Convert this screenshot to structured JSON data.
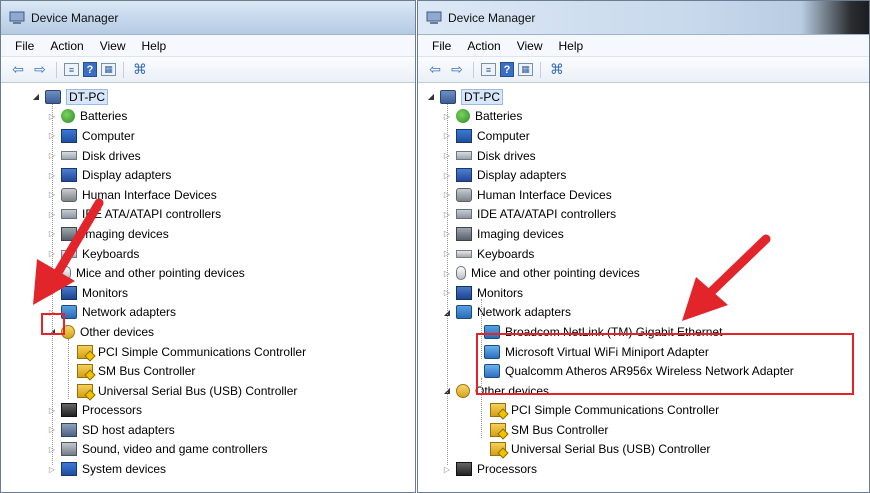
{
  "left": {
    "title": "Device Manager",
    "menu": [
      "File",
      "Action",
      "View",
      "Help"
    ],
    "root": "DT-PC",
    "items": [
      {
        "label": "Batteries",
        "icon": "battery-icon"
      },
      {
        "label": "Computer",
        "icon": "computer-icon"
      },
      {
        "label": "Disk drives",
        "icon": "disk-drive-icon"
      },
      {
        "label": "Display adapters",
        "icon": "display-adapter-icon"
      },
      {
        "label": "Human Interface Devices",
        "icon": "hid-icon"
      },
      {
        "label": "IDE ATA/ATAPI controllers",
        "icon": "ide-controller-icon"
      },
      {
        "label": "Imaging devices",
        "icon": "imaging-device-icon"
      },
      {
        "label": "Keyboards",
        "icon": "keyboard-icon"
      },
      {
        "label": "Mice and other pointing devices",
        "icon": "mouse-icon"
      },
      {
        "label": "Monitors",
        "icon": "monitor-icon"
      },
      {
        "label": "Network adapters",
        "icon": "network-adapter-icon"
      },
      {
        "label": "Other devices",
        "icon": "other-devices-icon"
      },
      {
        "label": "PCI Simple Communications Controller",
        "icon": "warning-device-icon"
      },
      {
        "label": "SM Bus Controller",
        "icon": "warning-device-icon"
      },
      {
        "label": "Universal Serial Bus (USB) Controller",
        "icon": "warning-device-icon"
      },
      {
        "label": "Processors",
        "icon": "processor-icon"
      },
      {
        "label": "SD host adapters",
        "icon": "sd-host-icon"
      },
      {
        "label": "Sound, video and game controllers",
        "icon": "sound-icon"
      },
      {
        "label": "System devices",
        "icon": "system-device-icon"
      }
    ]
  },
  "right": {
    "title": "Device Manager",
    "menu": [
      "File",
      "Action",
      "View",
      "Help"
    ],
    "root": "DT-PC",
    "items": [
      {
        "label": "Batteries",
        "icon": "battery-icon"
      },
      {
        "label": "Computer",
        "icon": "computer-icon"
      },
      {
        "label": "Disk drives",
        "icon": "disk-drive-icon"
      },
      {
        "label": "Display adapters",
        "icon": "display-adapter-icon"
      },
      {
        "label": "Human Interface Devices",
        "icon": "hid-icon"
      },
      {
        "label": "IDE ATA/ATAPI controllers",
        "icon": "ide-controller-icon"
      },
      {
        "label": "Imaging devices",
        "icon": "imaging-device-icon"
      },
      {
        "label": "Keyboards",
        "icon": "keyboard-icon"
      },
      {
        "label": "Mice and other pointing devices",
        "icon": "mouse-icon"
      },
      {
        "label": "Monitors",
        "icon": "monitor-icon"
      },
      {
        "label": "Network adapters",
        "icon": "network-adapter-icon"
      },
      {
        "label": "Broadcom NetLink (TM) Gigabit Ethernet",
        "icon": "ethernet-adapter-icon"
      },
      {
        "label": "Microsoft Virtual WiFi Miniport Adapter",
        "icon": "wifi-adapter-icon"
      },
      {
        "label": "Qualcomm Atheros AR956x Wireless Network Adapter",
        "icon": "wifi-adapter-icon"
      },
      {
        "label": "Other devices",
        "icon": "other-devices-icon"
      },
      {
        "label": "PCI Simple Communications Controller",
        "icon": "warning-device-icon"
      },
      {
        "label": "SM Bus Controller",
        "icon": "warning-device-icon"
      },
      {
        "label": "Universal Serial Bus (USB) Controller",
        "icon": "warning-device-icon"
      },
      {
        "label": "Processors",
        "icon": "processor-icon"
      }
    ]
  },
  "colors": {
    "annotation_red": "#e2252b",
    "selection_blue": "#d7e6f8",
    "title_gradient_top": "#dce8f5"
  }
}
